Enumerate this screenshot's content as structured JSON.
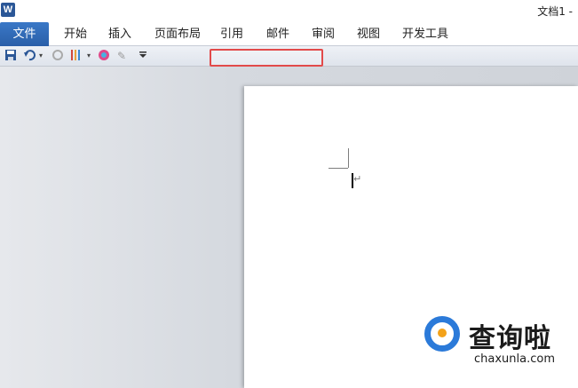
{
  "window": {
    "title": "文档1 -"
  },
  "ribbon": {
    "file_tab": "文件",
    "tabs": [
      "开始",
      "插入",
      "页面布局",
      "引用",
      "邮件",
      "审阅",
      "视图",
      "开发工具"
    ]
  },
  "quick_access": {
    "icons": [
      "save-icon",
      "undo-icon",
      "dropdown-icon",
      "redo-icon",
      "format-painter-icon",
      "dropdown-icon",
      "color-icon",
      "clear-icon",
      "customize-icon"
    ]
  },
  "document": {
    "paragraph_mark": "↵"
  },
  "watermark": {
    "brand": "查询啦",
    "url": "chaxunla.com"
  }
}
